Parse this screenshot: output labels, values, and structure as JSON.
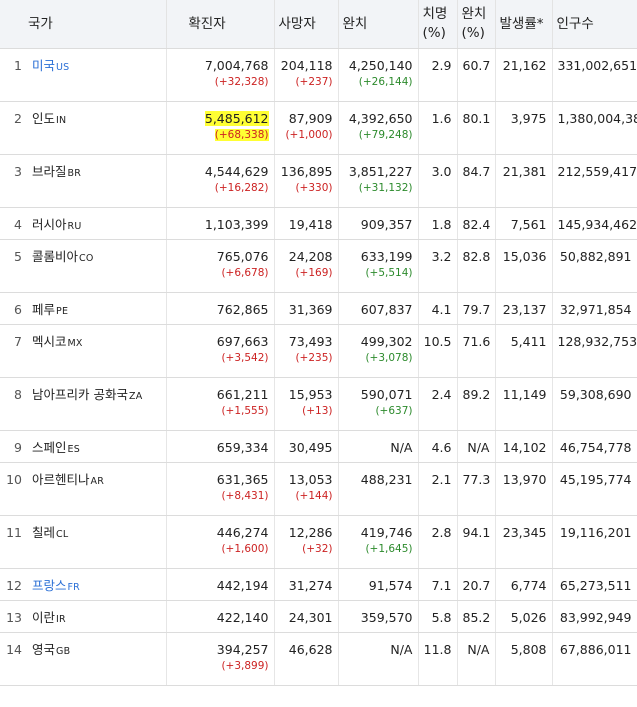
{
  "headers": {
    "country": "국가",
    "cases": "확진자",
    "deaths": "사망자",
    "recovered": "완치",
    "cfr_line1": "치명",
    "cfr_line2": "(%)",
    "rr_line1": "완치",
    "rr_line2": "(%)",
    "incidence": "발생률*",
    "population": "인구수"
  },
  "colors": {
    "increase": "#cc2222",
    "recovered_increase": "#2c8a2c",
    "link": "#2a6fd6",
    "highlight": "#ffff33"
  },
  "rows": [
    {
      "rank": "1",
      "name": "미국",
      "code": "US",
      "link": true,
      "cases": "7,004,768",
      "cases_delta": "(+32,328)",
      "deaths": "204,118",
      "deaths_delta": "(+237)",
      "recovered": "4,250,140",
      "recovered_delta": "(+26,144)",
      "cfr": "2.9",
      "rr": "60.7",
      "incidence": "21,162",
      "population": "331,002,651"
    },
    {
      "rank": "2",
      "name": "인도",
      "code": "IN",
      "link": false,
      "highlight": true,
      "cases": "5,485,612",
      "cases_delta": "(+68,338)",
      "deaths": "87,909",
      "deaths_delta": "(+1,000)",
      "recovered": "4,392,650",
      "recovered_delta": "(+79,248)",
      "cfr": "1.6",
      "rr": "80.1",
      "incidence": "3,975",
      "population": "1,380,004,385"
    },
    {
      "rank": "3",
      "name": "브라질",
      "code": "BR",
      "link": false,
      "cases": "4,544,629",
      "cases_delta": "(+16,282)",
      "deaths": "136,895",
      "deaths_delta": "(+330)",
      "recovered": "3,851,227",
      "recovered_delta": "(+31,132)",
      "cfr": "3.0",
      "rr": "84.7",
      "incidence": "21,381",
      "population": "212,559,417"
    },
    {
      "rank": "4",
      "name": "러시아",
      "code": "RU",
      "link": false,
      "cases": "1,103,399",
      "cases_delta": "",
      "deaths": "19,418",
      "deaths_delta": "",
      "recovered": "909,357",
      "recovered_delta": "",
      "cfr": "1.8",
      "rr": "82.4",
      "incidence": "7,561",
      "population": "145,934,462"
    },
    {
      "rank": "5",
      "name": "콜롬비아",
      "code": "CO",
      "link": false,
      "cases": "765,076",
      "cases_delta": "(+6,678)",
      "deaths": "24,208",
      "deaths_delta": "(+169)",
      "recovered": "633,199",
      "recovered_delta": "(+5,514)",
      "cfr": "3.2",
      "rr": "82.8",
      "incidence": "15,036",
      "population": "50,882,891"
    },
    {
      "rank": "6",
      "name": "페루",
      "code": "PE",
      "link": false,
      "cases": "762,865",
      "cases_delta": "",
      "deaths": "31,369",
      "deaths_delta": "",
      "recovered": "607,837",
      "recovered_delta": "",
      "cfr": "4.1",
      "rr": "79.7",
      "incidence": "23,137",
      "population": "32,971,854"
    },
    {
      "rank": "7",
      "name": "멕시코",
      "code": "MX",
      "link": false,
      "cases": "697,663",
      "cases_delta": "(+3,542)",
      "deaths": "73,493",
      "deaths_delta": "(+235)",
      "recovered": "499,302",
      "recovered_delta": "(+3,078)",
      "cfr": "10.5",
      "rr": "71.6",
      "incidence": "5,411",
      "population": "128,932,753"
    },
    {
      "rank": "8",
      "name": "남아프리카 공화국",
      "code": "ZA",
      "link": false,
      "cases": "661,211",
      "cases_delta": "(+1,555)",
      "deaths": "15,953",
      "deaths_delta": "(+13)",
      "recovered": "590,071",
      "recovered_delta": "(+637)",
      "cfr": "2.4",
      "rr": "89.2",
      "incidence": "11,149",
      "population": "59,308,690"
    },
    {
      "rank": "9",
      "name": "스페인",
      "code": "ES",
      "link": false,
      "cases": "659,334",
      "cases_delta": "",
      "deaths": "30,495",
      "deaths_delta": "",
      "recovered": "N/A",
      "recovered_delta": "",
      "cfr": "4.6",
      "rr": "N/A",
      "incidence": "14,102",
      "population": "46,754,778"
    },
    {
      "rank": "10",
      "name": "아르헨티나",
      "code": "AR",
      "link": false,
      "cases": "631,365",
      "cases_delta": "(+8,431)",
      "deaths": "13,053",
      "deaths_delta": "(+144)",
      "recovered": "488,231",
      "recovered_delta": "",
      "cfr": "2.1",
      "rr": "77.3",
      "incidence": "13,970",
      "population": "45,195,774"
    },
    {
      "rank": "11",
      "name": "칠레",
      "code": "CL",
      "link": false,
      "cases": "446,274",
      "cases_delta": "(+1,600)",
      "deaths": "12,286",
      "deaths_delta": "(+32)",
      "recovered": "419,746",
      "recovered_delta": "(+1,645)",
      "cfr": "2.8",
      "rr": "94.1",
      "incidence": "23,345",
      "population": "19,116,201"
    },
    {
      "rank": "12",
      "name": "프랑스",
      "code": "FR",
      "link": true,
      "cases": "442,194",
      "cases_delta": "",
      "deaths": "31,274",
      "deaths_delta": "",
      "recovered": "91,574",
      "recovered_delta": "",
      "cfr": "7.1",
      "rr": "20.7",
      "incidence": "6,774",
      "population": "65,273,511"
    },
    {
      "rank": "13",
      "name": "이란",
      "code": "IR",
      "link": false,
      "cases": "422,140",
      "cases_delta": "",
      "deaths": "24,301",
      "deaths_delta": "",
      "recovered": "359,570",
      "recovered_delta": "",
      "cfr": "5.8",
      "rr": "85.2",
      "incidence": "5,026",
      "population": "83,992,949"
    },
    {
      "rank": "14",
      "name": "영국",
      "code": "GB",
      "link": false,
      "cases": "394,257",
      "cases_delta": "(+3,899)",
      "deaths": "46,628",
      "deaths_delta": "",
      "recovered": "N/A",
      "recovered_delta": "",
      "cfr": "11.8",
      "rr": "N/A",
      "incidence": "5,808",
      "population": "67,886,011"
    }
  ]
}
